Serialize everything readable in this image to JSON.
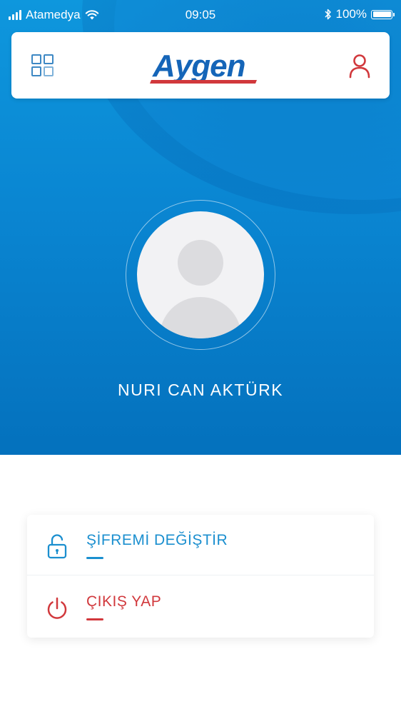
{
  "status_bar": {
    "carrier": "Atamedya",
    "time": "09:05",
    "battery": "100%"
  },
  "header": {
    "logo_text": "Aygen",
    "icons": {
      "menu": "grid-icon",
      "profile": "user-icon"
    }
  },
  "profile": {
    "name": "NURI CAN AKTÜRK",
    "avatar": "avatar-placeholder-icon"
  },
  "menu": {
    "items": [
      {
        "label": "ŞİFREMİ DEĞİŞTİR",
        "icon": "unlock-icon",
        "color": "#1b8fcf"
      },
      {
        "label": "ÇIKIŞ YAP",
        "icon": "power-icon",
        "color": "#d1383c"
      }
    ]
  },
  "colors": {
    "brand_blue": "#1565b8",
    "brand_red": "#d1383c",
    "hero_top": "#0e97dd",
    "hero_bottom": "#0471bd",
    "accent_blue": "#1b8fcf"
  }
}
